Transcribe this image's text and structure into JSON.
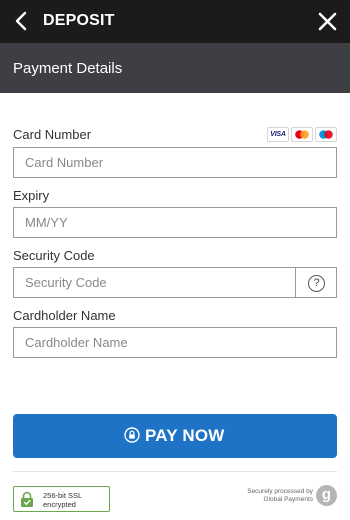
{
  "header": {
    "title": "DEPOSIT",
    "back_icon": "chevron-left-icon",
    "close_icon": "close-icon"
  },
  "subheader": {
    "title": "Payment Details"
  },
  "form": {
    "card_number": {
      "label": "Card Number",
      "placeholder": "Card Number",
      "value": ""
    },
    "card_brands": [
      {
        "name": "visa",
        "text": "VISA",
        "color": "#1a1f71"
      },
      {
        "name": "mastercard",
        "colors": [
          "#eb001b",
          "#f79e1b"
        ]
      },
      {
        "name": "maestro",
        "colors": [
          "#0099df",
          "#eb001b"
        ]
      }
    ],
    "expiry": {
      "label": "Expiry",
      "placeholder": "MM/YY",
      "value": ""
    },
    "security_code": {
      "label": "Security Code",
      "placeholder": "Security Code",
      "value": "",
      "help_icon": "question-circle-icon",
      "help_text": "?"
    },
    "cardholder_name": {
      "label": "Cardholder Name",
      "placeholder": "Cardholder Name",
      "value": ""
    }
  },
  "pay_button": {
    "label": "PAY NOW",
    "icon": "lock-icon",
    "color": "#1f73c6"
  },
  "footer": {
    "ssl_line1": "256-bit SSL",
    "ssl_line2": "encrypted",
    "ssl_icon": "lock-icon",
    "processed_line1": "Securely processed by",
    "processed_line2": "Global Payments",
    "logo_letter": "g"
  },
  "colors": {
    "topbar": "#1b1b1b",
    "subbar": "#3d3f45",
    "accent": "#1f73c6",
    "ssl_green": "#6aa84f"
  }
}
